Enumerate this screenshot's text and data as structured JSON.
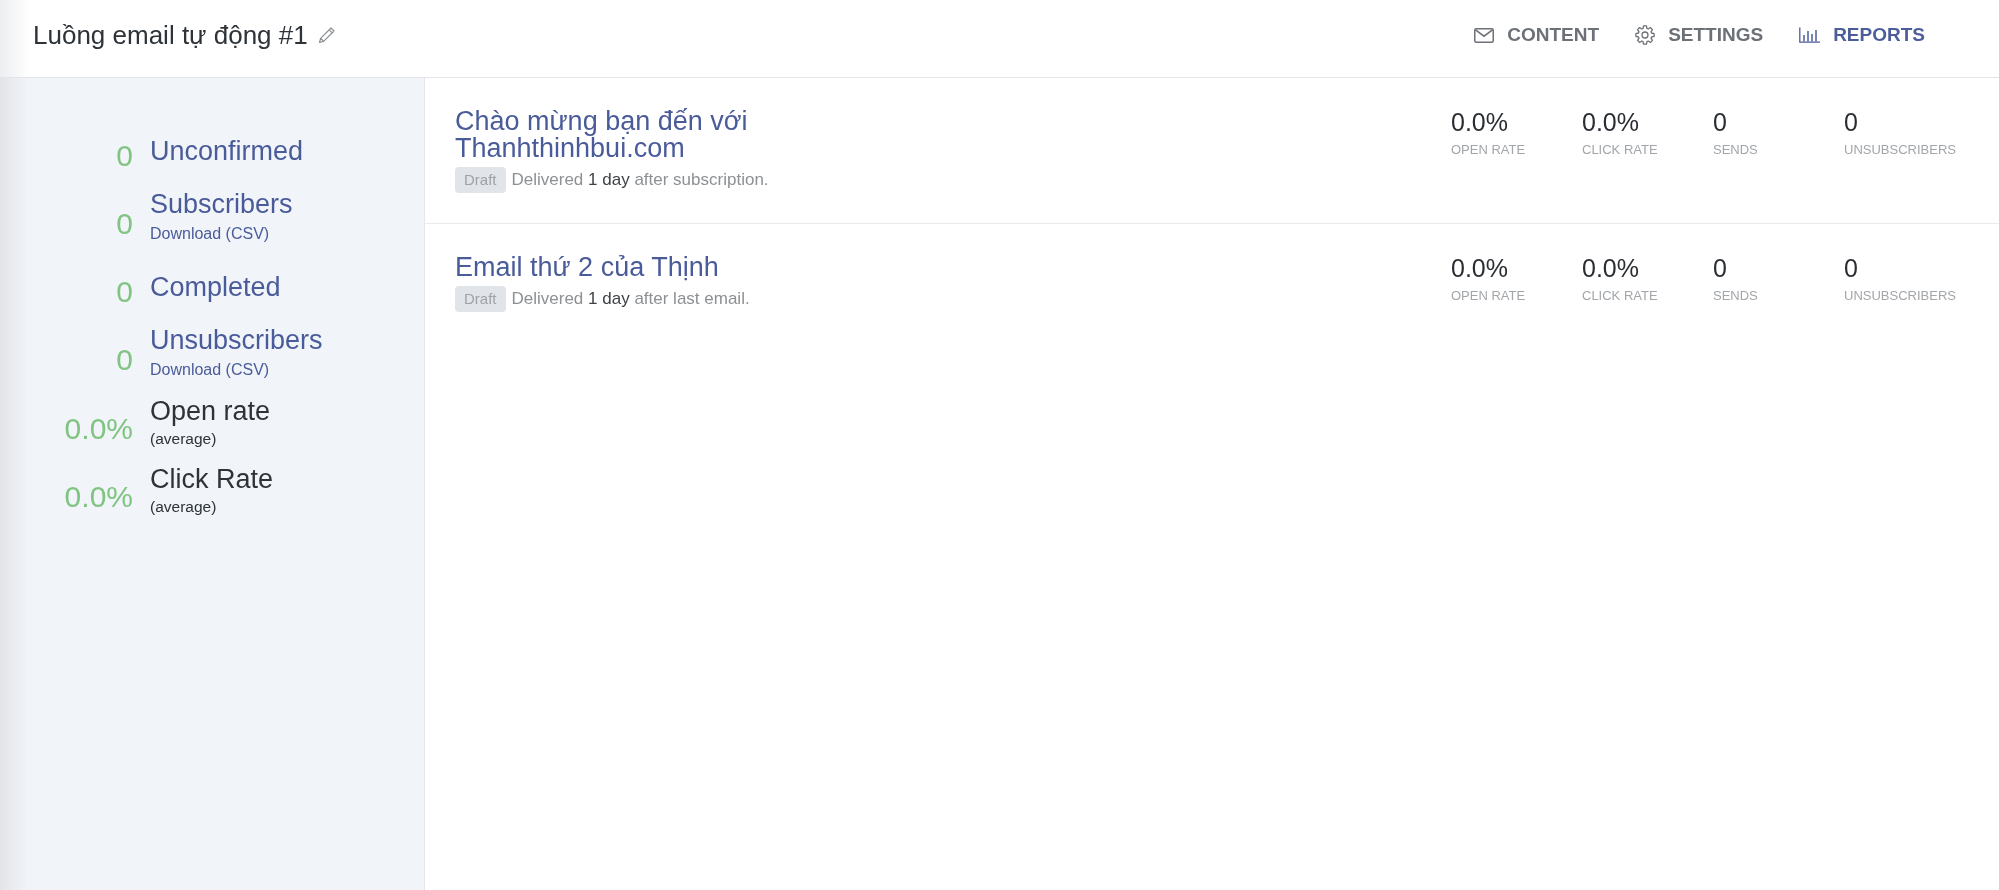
{
  "header": {
    "title": "Luồng email tự động #1",
    "tabs": [
      {
        "label": "CONTENT",
        "selected": false
      },
      {
        "label": "SETTINGS",
        "selected": false
      },
      {
        "label": "REPORTS",
        "selected": true
      }
    ]
  },
  "sidebar": {
    "counts": [
      {
        "value": "0",
        "label": "Unconfirmed"
      },
      {
        "value": "0",
        "label": "Subscribers",
        "download": "Download (CSV)"
      },
      {
        "value": "0",
        "label": "Completed"
      },
      {
        "value": "0",
        "label": "Unsubscribers",
        "download": "Download (CSV)"
      }
    ],
    "rates": [
      {
        "value": "0.0%",
        "label": "Open rate",
        "note": "(average)"
      },
      {
        "value": "0.0%",
        "label": "Click Rate",
        "note": "(average)"
      }
    ]
  },
  "emails": [
    {
      "title": "Chào mừng bạn đến với Thanhthinhbui.com",
      "status": "Draft",
      "delivery": "Delivered **1 day** after subscription.",
      "metrics": [
        {
          "value": "0.0%",
          "label": "OPEN RATE"
        },
        {
          "value": "0.0%",
          "label": "CLICK RATE"
        },
        {
          "value": "0",
          "label": "SENDS"
        },
        {
          "value": "0",
          "label": "UNSUBSCRIBERS"
        }
      ]
    },
    {
      "title": "Email thứ 2 của Thịnh",
      "status": "Draft",
      "delivery": "Delivered **1 day** after last email.",
      "metrics": [
        {
          "value": "0.0%",
          "label": "OPEN RATE"
        },
        {
          "value": "0.0%",
          "label": "CLICK RATE"
        },
        {
          "value": "0",
          "label": "SENDS"
        },
        {
          "value": "0",
          "label": "UNSUBSCRIBERS"
        }
      ]
    }
  ]
}
